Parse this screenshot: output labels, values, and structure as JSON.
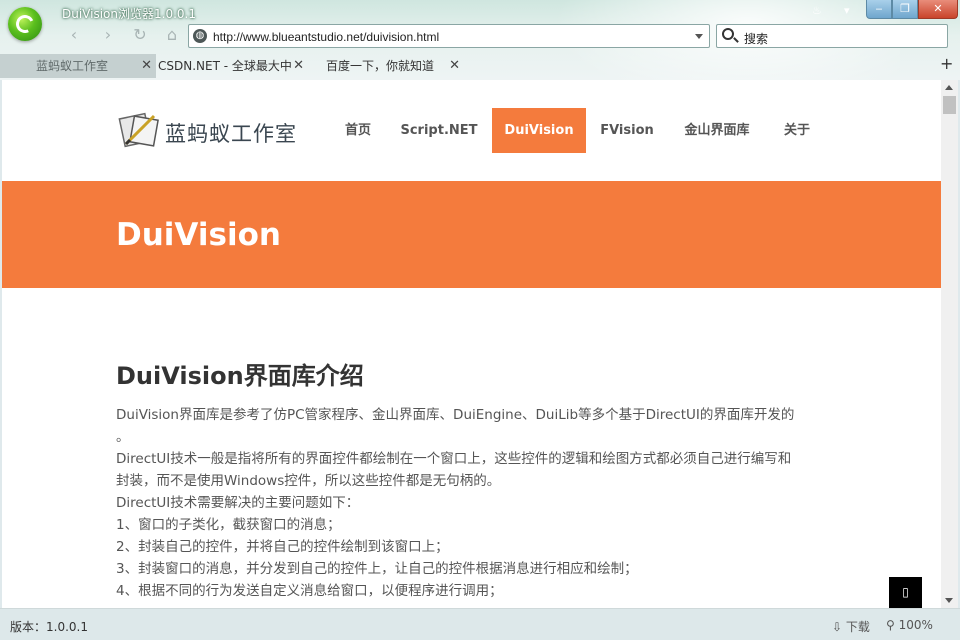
{
  "window": {
    "title": "DuiVision浏览器1.0.0.1",
    "controls": {
      "minimize": "‒",
      "maximize": "❐",
      "close": "✕"
    }
  },
  "toolbar": {
    "back_icon": "chevron-left-icon",
    "forward_icon": "chevron-right-icon",
    "refresh_icon": "refresh-icon",
    "home_icon": "home-icon",
    "address_value": "http://www.blueantstudio.net/duivision.html",
    "search_placeholder": "搜索"
  },
  "tabs": [
    {
      "label": "蓝蚂蚁工作室",
      "active": true
    },
    {
      "label": "CSDN.NET - 全球最大中",
      "active": false
    },
    {
      "label": "百度一下，你就知道",
      "active": false
    }
  ],
  "page": {
    "brand": "蓝蚂蚁工作室",
    "menu": [
      {
        "label": "首页"
      },
      {
        "label": "Script.NET"
      },
      {
        "label": "DuiVision",
        "active": true
      },
      {
        "label": "FVision"
      },
      {
        "label": "金山界面库"
      },
      {
        "label": "关于"
      }
    ],
    "hero_title": "DuiVision",
    "heading": "DuiVision界面库介绍",
    "paragraphs": [
      "DuiVision界面库是参考了仿PC管家程序、金山界面库、DuiEngine、DuiLib等多个基于DirectUI的界面库开发的",
      "。",
      "DirectUI技术一般是指将所有的界面控件都绘制在一个窗口上，这些控件的逻辑和绘图方式都必须自己进行编写和",
      "封装，而不是使用Windows控件，所以这些控件都是无句柄的。",
      "DirectUI技术需要解决的主要问题如下：",
      "1、窗口的子类化，截获窗口的消息；",
      "2、封装自己的控件，并将自己的控件绘制到该窗口上；",
      "3、封装窗口的消息，并分发到自己的控件上，让自己的控件根据消息进行相应和绘制；",
      "4、根据不同的行为发送自定义消息给窗口，以便程序进行调用；"
    ],
    "to_top_icon": "▯"
  },
  "status": {
    "version": "版本：1.0.0.1",
    "download": "下载",
    "zoom": "100%"
  },
  "colors": {
    "accent": "#f47b3d",
    "chrome": "#dfe9ec"
  }
}
